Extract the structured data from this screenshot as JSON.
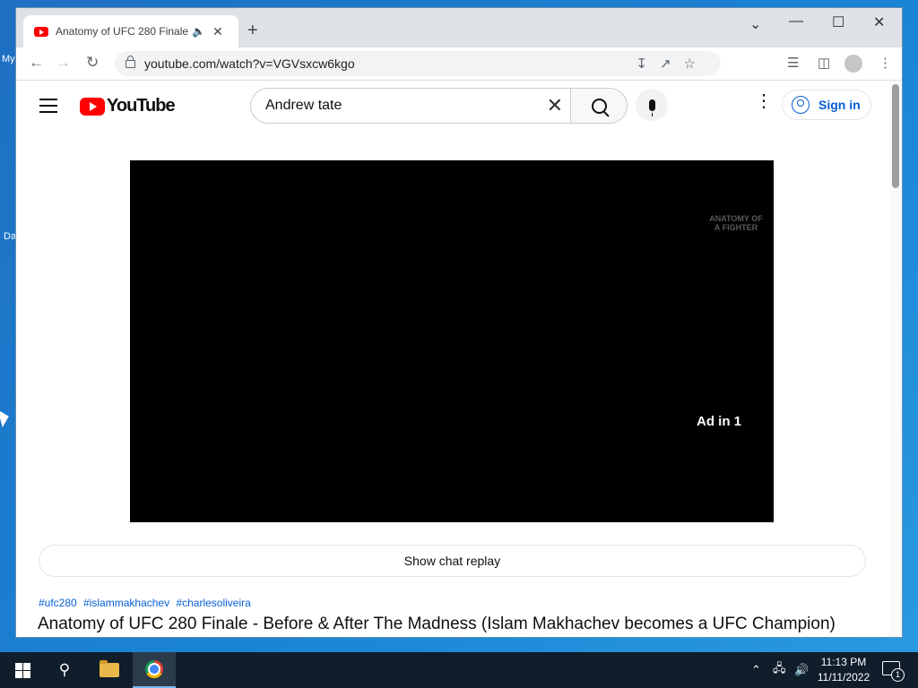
{
  "desktop": {
    "frag_top": "My",
    "frag_mid": "Da"
  },
  "browser": {
    "tab_title": "Anatomy of UFC 280 Finale -",
    "url": "youtube.com/watch?v=VGVsxcw6kgo"
  },
  "youtube": {
    "logo_text": "YouTube",
    "search_value": "Andrew tate",
    "signin_label": "Sign in",
    "ad_label": "Ad in 1",
    "watermark": "ANATOMY OF A FIGHTER",
    "chat_replay": "Show chat replay",
    "hashtags": [
      "#ufc280",
      "#islammakhachev",
      "#charlesoliveira"
    ],
    "title": "Anatomy of UFC 280 Finale - Before & After The Madness (Islam Makhachev becomes a UFC Champion)"
  },
  "taskbar": {
    "time": "11:13 PM",
    "date": "11/11/2022",
    "notif_count": "1"
  }
}
